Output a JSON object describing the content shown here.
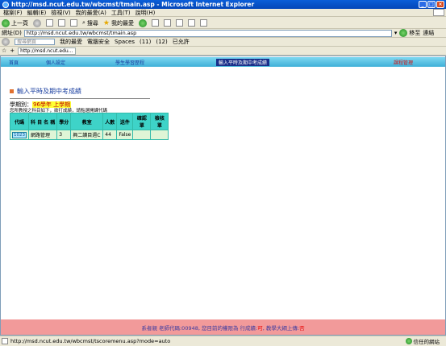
{
  "window": {
    "title": "http://msd.ncut.edu.tw/wbcmst/tmain.asp - Microsoft Internet Explorer"
  },
  "menu": [
    "檔案(F)",
    "編輯(E)",
    "檢視(V)",
    "我的最愛(A)",
    "工具(T)",
    "說明(H)"
  ],
  "toolbar": {
    "back_label": "上一頁",
    "search_label": "搜尋",
    "favorites_label": "我的最愛"
  },
  "address": {
    "label": "網址(D)",
    "url": "http://msd.ncut.edu.tw/wbcmst/tmain.asp",
    "go_label": "移至",
    "links_label": "連結"
  },
  "gbar": {
    "search_placeholder": "搜尋網頁",
    "items": [
      "我的最愛",
      "電腦安全",
      "Spaces",
      "(11)",
      "(12)",
      "已允許"
    ]
  },
  "tab": {
    "label": "http://msd.ncut.edu..."
  },
  "nav": {
    "items": [
      "首頁",
      "個人設定",
      "學生學習歷程",
      "輸入平時及期中考成績",
      "課程管理"
    ]
  },
  "page": {
    "heading": "輸入平時及期中考成績",
    "term_label": "學期別：",
    "term_value": "96學年 上學期",
    "note": "您所教授之科目如下，欲打成績，請點選開課代碼"
  },
  "table": {
    "headers": [
      "代碼",
      "科 目 名 稱",
      "學分",
      "教室",
      "人數",
      "送件",
      "確認單",
      "檢核單"
    ],
    "rows": [
      [
        "1023",
        "網路管理",
        "3",
        "興二讀目週C",
        "44",
        "False",
        "",
        ""
      ]
    ]
  },
  "footer": {
    "prefix": "系者親 老師代碼:00948, 您目前的權限為 行成績:",
    "perm1": "可",
    "mid": ", 教學大綱上傳:",
    "perm2": "否"
  },
  "status": {
    "url": "http://msd.ncut.edu.tw/wbcmst/tscoremenu.asp?mode=auto",
    "zone": "信任的網站"
  }
}
